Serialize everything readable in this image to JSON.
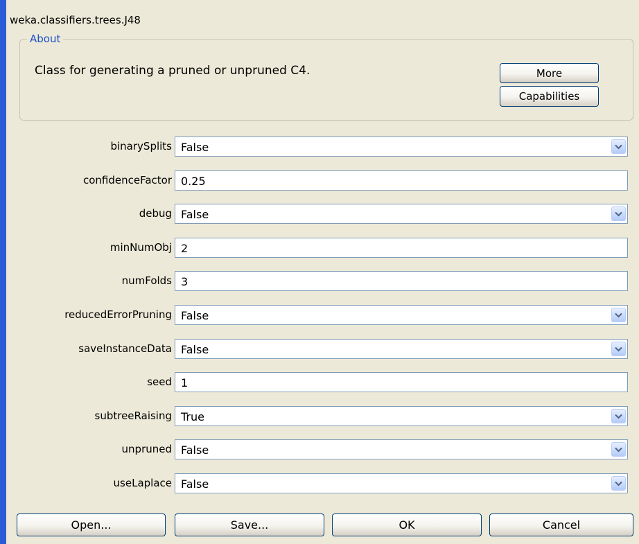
{
  "title": "weka.classifiers.trees.J48",
  "about": {
    "legend": "About",
    "text": "Class for generating a pruned or unpruned C4.",
    "more_label": "More",
    "capabilities_label": "Capabilities"
  },
  "properties": [
    {
      "name": "binarySplits",
      "value": "False",
      "type": "dropdown"
    },
    {
      "name": "confidenceFactor",
      "value": "0.25",
      "type": "text"
    },
    {
      "name": "debug",
      "value": "False",
      "type": "dropdown"
    },
    {
      "name": "minNumObj",
      "value": "2",
      "type": "text"
    },
    {
      "name": "numFolds",
      "value": "3",
      "type": "text"
    },
    {
      "name": "reducedErrorPruning",
      "value": "False",
      "type": "dropdown"
    },
    {
      "name": "saveInstanceData",
      "value": "False",
      "type": "dropdown"
    },
    {
      "name": "seed",
      "value": "1",
      "type": "text"
    },
    {
      "name": "subtreeRaising",
      "value": "True",
      "type": "dropdown"
    },
    {
      "name": "unpruned",
      "value": "False",
      "type": "dropdown"
    },
    {
      "name": "useLaplace",
      "value": "False",
      "type": "dropdown"
    }
  ],
  "buttons": {
    "open": "Open...",
    "save": "Save...",
    "ok": "OK",
    "cancel": "Cancel"
  },
  "icons": {
    "dropdown": "chevron-down-icon"
  },
  "colors": {
    "window_bg": "#ece9d8",
    "accent": "#2a5bd7",
    "legend_text": "#1c50c9"
  }
}
